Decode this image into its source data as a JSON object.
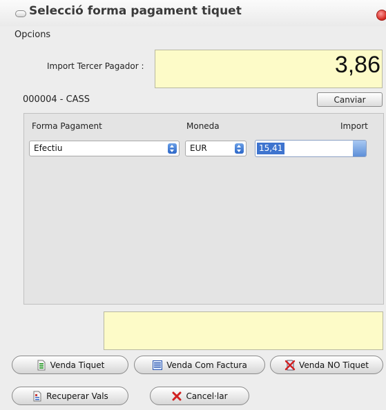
{
  "window": {
    "title": "Selecció forma pagament tiquet"
  },
  "menu": {
    "opcions": "Opcions"
  },
  "third_payer": {
    "label": "Import Tercer Pagador :",
    "amount": "3,86",
    "entity": "000004 - CASS",
    "change_button": "Canviar"
  },
  "payment": {
    "headers": {
      "method": "Forma Pagament",
      "currency": "Moneda",
      "amount": "Import"
    },
    "method_value": "Efectiu",
    "currency_value": "EUR",
    "amount_value": "15,41"
  },
  "actions": {
    "venda_tiquet": "Venda Tiquet",
    "venda_com_factura": "Venda Com Factura",
    "venda_no_tiquet": "Venda NO Tiquet",
    "recuperar_vals": "Recuperar Vals",
    "cancellar": "Cancel·lar"
  },
  "icons": {
    "venda_tiquet": "document-green-icon",
    "venda_com_factura": "invoice-list-icon",
    "venda_no_tiquet": "no-ticket-x-icon",
    "recuperar_vals": "voucher-icon",
    "cancellar": "red-x-icon"
  },
  "colors": {
    "highlight_field": "#fdfbc8",
    "selection": "#3e74cf",
    "close_button": "#d1261e"
  }
}
